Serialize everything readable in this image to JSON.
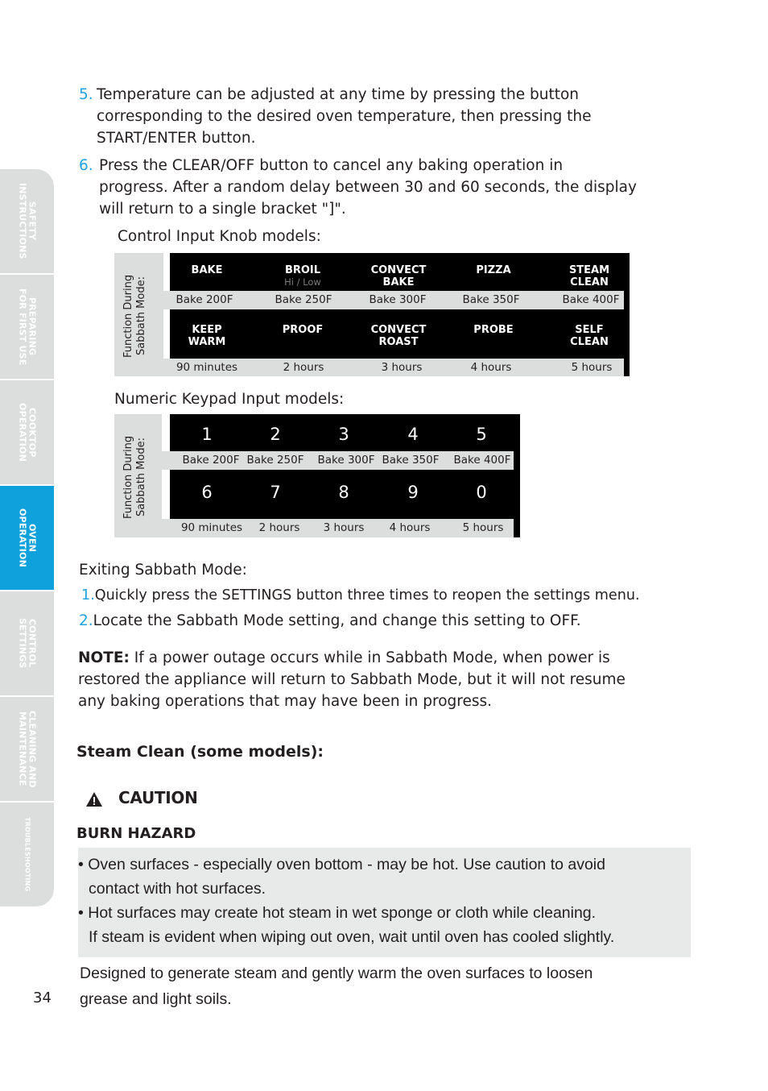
{
  "page_number": "34",
  "side_tabs": [
    {
      "label": "SAFETY\nINSTRUCTIONS",
      "active": false
    },
    {
      "label": "PREPARING\nFOR FIRST USE",
      "active": false
    },
    {
      "label": "COOKTOP\nOPERATION",
      "active": false
    },
    {
      "label": "OVEN\nOPERATION",
      "active": true
    },
    {
      "label": "CONTROL\nSETTINGS",
      "active": false
    },
    {
      "label": "CLEANING AND\nMAINTENANCE",
      "active": false
    },
    {
      "label": "TROUBLESHOOTING",
      "active": false
    }
  ],
  "steps": [
    {
      "num": "5.",
      "lines": [
        "Temperature can be adjusted at any time by pressing the button",
        "corresponding to the desired oven temperature, then pressing the",
        "START/ENTER button."
      ]
    },
    {
      "num": "6.",
      "lines": [
        "Press the CLEAR/OFF button to cancel any baking operation in",
        "progress. After a random delay between 30 and 60 seconds, the display",
        "will return to a single bracket \"]\"."
      ]
    }
  ],
  "knob_section": {
    "heading": "Control Input Knob models:",
    "side_label": "Function During\nSabbath Mode:",
    "row1_buttons": [
      {
        "label": "BAKE",
        "sub": ""
      },
      {
        "label": "BROIL",
        "sub": "Hi / Low"
      },
      {
        "label": "CONVECT\nBAKE",
        "sub": ""
      },
      {
        "label": "PIZZA",
        "sub": ""
      },
      {
        "label": "STEAM\nCLEAN",
        "sub": ""
      }
    ],
    "row1_values": [
      "Bake 200F",
      "Bake 250F",
      "Bake 300F",
      "Bake 350F",
      "Bake 400F"
    ],
    "row2_buttons": [
      {
        "label": "KEEP\nWARM"
      },
      {
        "label": "PROOF"
      },
      {
        "label": "CONVECT\nROAST"
      },
      {
        "label": "PROBE"
      },
      {
        "label": "SELF\nCLEAN"
      }
    ],
    "row2_values": [
      "90 minutes",
      "2 hours",
      "3 hours",
      "4 hours",
      "5 hours"
    ]
  },
  "keypad_section": {
    "heading": "Numeric Keypad Input models:",
    "side_label": "Function During\nSabbath Mode:",
    "row1_keys": [
      "1",
      "2",
      "3",
      "4",
      "5"
    ],
    "row1_values": [
      "Bake 200F",
      "Bake 250F",
      "Bake 300F",
      "Bake 350F",
      "Bake 400F"
    ],
    "row2_keys": [
      "6",
      "7",
      "8",
      "9",
      "0"
    ],
    "row2_values": [
      "90 minutes",
      "2 hours",
      "3 hours",
      "4 hours",
      "5 hours"
    ]
  },
  "exiting": {
    "heading": "Exiting Sabbath Mode:",
    "steps": [
      {
        "num": "1.",
        "text": "Quickly press the SETTINGS button three times to reopen the settings menu."
      },
      {
        "num": "2.",
        "text": "Locate the Sabbath Mode setting, and change this setting to OFF."
      }
    ]
  },
  "note": {
    "label": "NOTE:",
    "lines": [
      " If a power outage occurs while in Sabbath Mode, when power is",
      "restored the appliance will return to Sabbath Mode, but it will not resume",
      "any baking operations that may have been in progress."
    ]
  },
  "steam_clean": {
    "heading": "Steam Clean (some models):",
    "caution_label": "CAUTION",
    "hazard_title": "BURN HAZARD",
    "bullets": [
      [
        "Oven surfaces - especially oven bottom - may be hot. Use caution to avoid",
        "contact with hot surfaces."
      ],
      [
        "Hot surfaces may create hot steam in wet sponge or cloth while cleaning.",
        "If steam is evident when wiping out oven, wait until oven has cooled slightly."
      ]
    ],
    "description_lines": [
      "Designed to generate steam and gently warm the oven surfaces to loosen",
      "grease and light soils."
    ]
  },
  "colors": {
    "accent_blue": "#1fa3dc",
    "tab_active": "#0ea1dc",
    "tab_inactive": "#dcdddd",
    "caution_bg": "#e8e9e9"
  }
}
